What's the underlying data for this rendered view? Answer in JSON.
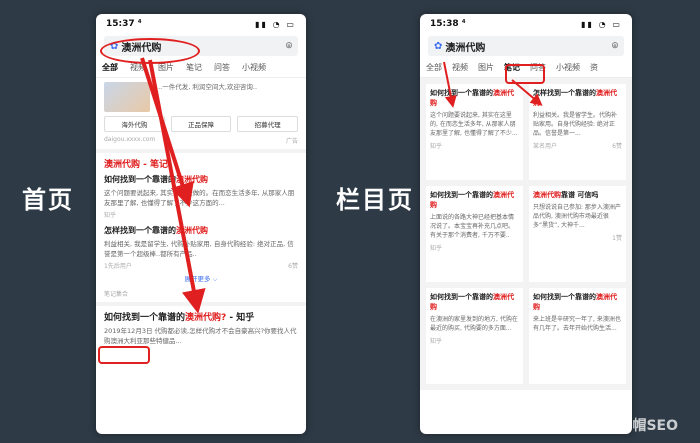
{
  "labels": {
    "home": "首页",
    "column": "栏目页"
  },
  "left": {
    "time": "15:37 ⁴",
    "query": "澳洲代购",
    "tabs": [
      "全部",
      "视频",
      "图片",
      "笔记",
      "问答",
      "小视频"
    ],
    "ad_snippet": "...一件代发, 利润空间大,欢迎咨询..",
    "buttons": [
      "海外代购",
      "正品保障",
      "招募代理"
    ],
    "ad_meta": "daigou.xxxx.com",
    "ad_tag": "广告",
    "section_title": "澳洲代购 - 笔记",
    "note1": {
      "title_prefix": "如何找到一个靠谱的",
      "title_red": "澳洲代购",
      "snippet": "这个问题要说起来, 其实要看是做的。在而恋生活多年, 从那家人朋友那里了解, 也懂得了解了不少这方面的...",
      "meta": "知乎"
    },
    "note2": {
      "title_prefix": "怎样找到一个靠谱的",
      "title_red": "澳洲代购",
      "snippet": "利益相关, 我是留学生, 代购补贴家用, 自身代购经验: 绝对正品, 信誉是第一个超级棒..都所有产品..",
      "meta": "1先后用户",
      "meta_right": "6赞"
    },
    "more": "展开更多 ⌵",
    "source_tag": "笔记集合",
    "result_title_prefix": "如何找到一个靠谱的",
    "result_title_red": "澳洲代购?",
    "result_title_suffix": " - 知乎",
    "result_snippet": "2019年12月3日 代购都必读,怎样代购才不会自豪高兴?你要找人代购澳洲大利亚那些特健品..."
  },
  "right": {
    "time": "15:38 ⁴",
    "query": "澳洲代购",
    "tabs": [
      "全部",
      "视频",
      "图片",
      "笔记",
      "问答",
      "小视频",
      "资"
    ],
    "cards": [
      {
        "title_prefix": "如何找到一个靠谱的",
        "title_red": "澳洲代购",
        "snippet": "这个问题要说起来, 其实在这里的, 在而恋生活多年, 从那家人朋友那里了解, 也懂得了解了不少...",
        "meta": "知乎",
        "meta_right": ""
      },
      {
        "title_prefix": "怎样找到一个靠谱的",
        "title_red": "澳洲代购",
        "snippet": "利益相关。我是留学生。代购补贴家用。自身代购经验: 绝对正品。信誉是第一...",
        "meta": "某名用户",
        "meta_right": "6赞"
      },
      {
        "title_prefix": "如何找到一个靠谱的",
        "title_red": "澳洲代购",
        "snippet": "上面说的各路大神已经把基本情况说了。本宝宝再补充几点吧。有关于那个消费者, 千万不要..",
        "meta": "知乎",
        "meta_right": ""
      },
      {
        "title_prefix": "",
        "title_red": "澳洲代购",
        "title_suffix": "靠谱 可信吗",
        "snippet": "只想说说自己参加: 那步入澳洲产品代购, 澳洲代购市场最近很多“黑货”, 大神千...",
        "meta": "",
        "meta_right": "1赞"
      },
      {
        "title_prefix": "如何找到一个靠谱的",
        "title_red": "澳洲代购",
        "snippet": "在澳洲的家里发到的地方, 代购在最近的购买, 代购要的多方面...",
        "meta": "知乎",
        "meta_right": ""
      },
      {
        "title_prefix": "如何找到一个靠谱的",
        "title_red": "澳洲代购",
        "snippet": "来上班是辛研究一年了, 来澳洲也有几年了。去年开始代购生活...",
        "meta": "",
        "meta_right": ""
      }
    ]
  },
  "watermark": "知乎 ◎ 白帽SEO",
  "colors": {
    "accent": "#e02020",
    "bg": "#2e3a46",
    "link": "#3a6df0"
  }
}
